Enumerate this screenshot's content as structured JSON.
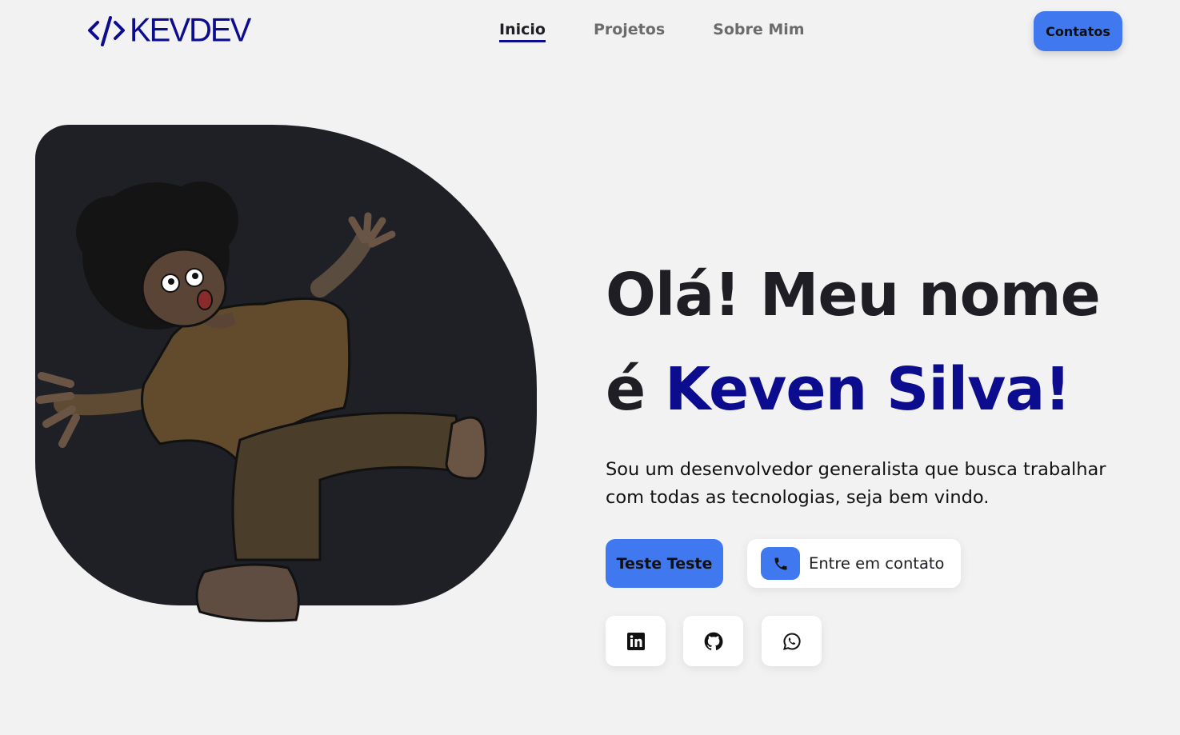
{
  "header": {
    "logo_text": "KEVDEV",
    "nav": [
      {
        "label": "Inicio",
        "active": true
      },
      {
        "label": "Projetos",
        "active": false
      },
      {
        "label": "Sobre Mim",
        "active": false
      }
    ],
    "contact_button": "Contatos"
  },
  "hero": {
    "title_line1": "Olá! Meu nome",
    "title_line2_prefix": "é ",
    "title_name": "Keven Silva!",
    "description": "Sou um desenvolvedor generalista que busca trabalhar com todas as tecnologias, seja bem vindo.",
    "primary_button": "Teste Teste",
    "secondary_button": "Entre em contato",
    "secondary_icon": "phone-icon",
    "socials": [
      "linkedin-icon",
      "github-icon",
      "whatsapp-icon"
    ]
  },
  "colors": {
    "accent": "#3f78ef",
    "brand": "#0c0c8f",
    "dark": "#1f2026",
    "background": "#f2f2f2"
  }
}
